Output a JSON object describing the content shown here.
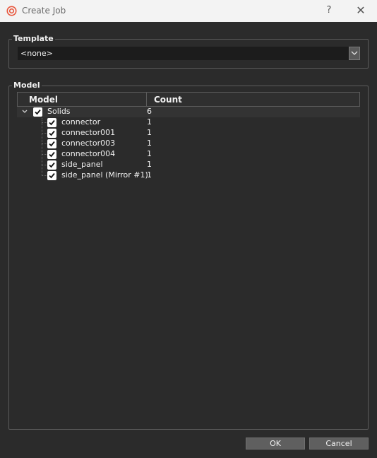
{
  "window": {
    "title": "Create Job",
    "help_glyph": "?",
    "close_glyph": "✕",
    "icon": "app-logo-icon"
  },
  "template": {
    "group_label": "Template",
    "selected_value": "<none>"
  },
  "model": {
    "group_label": "Model",
    "columns": {
      "model": "Model",
      "count": "Count"
    },
    "root": {
      "label": "Solids",
      "count": "6",
      "checked": true,
      "expanded": true
    },
    "children": [
      {
        "label": "connector",
        "count": "1",
        "checked": true
      },
      {
        "label": "connector001",
        "count": "1",
        "checked": true
      },
      {
        "label": "connector003",
        "count": "1",
        "checked": true
      },
      {
        "label": "connector004",
        "count": "1",
        "checked": true
      },
      {
        "label": "side_panel",
        "count": "1",
        "checked": true
      },
      {
        "label": "side_panel (Mirror #1)",
        "count": "1",
        "checked": true
      }
    ]
  },
  "buttons": {
    "ok": "OK",
    "cancel": "Cancel"
  },
  "colors": {
    "background": "#2b2b2b",
    "titlebar": "#f3f3f3",
    "accent_icon": "#e8543a"
  }
}
